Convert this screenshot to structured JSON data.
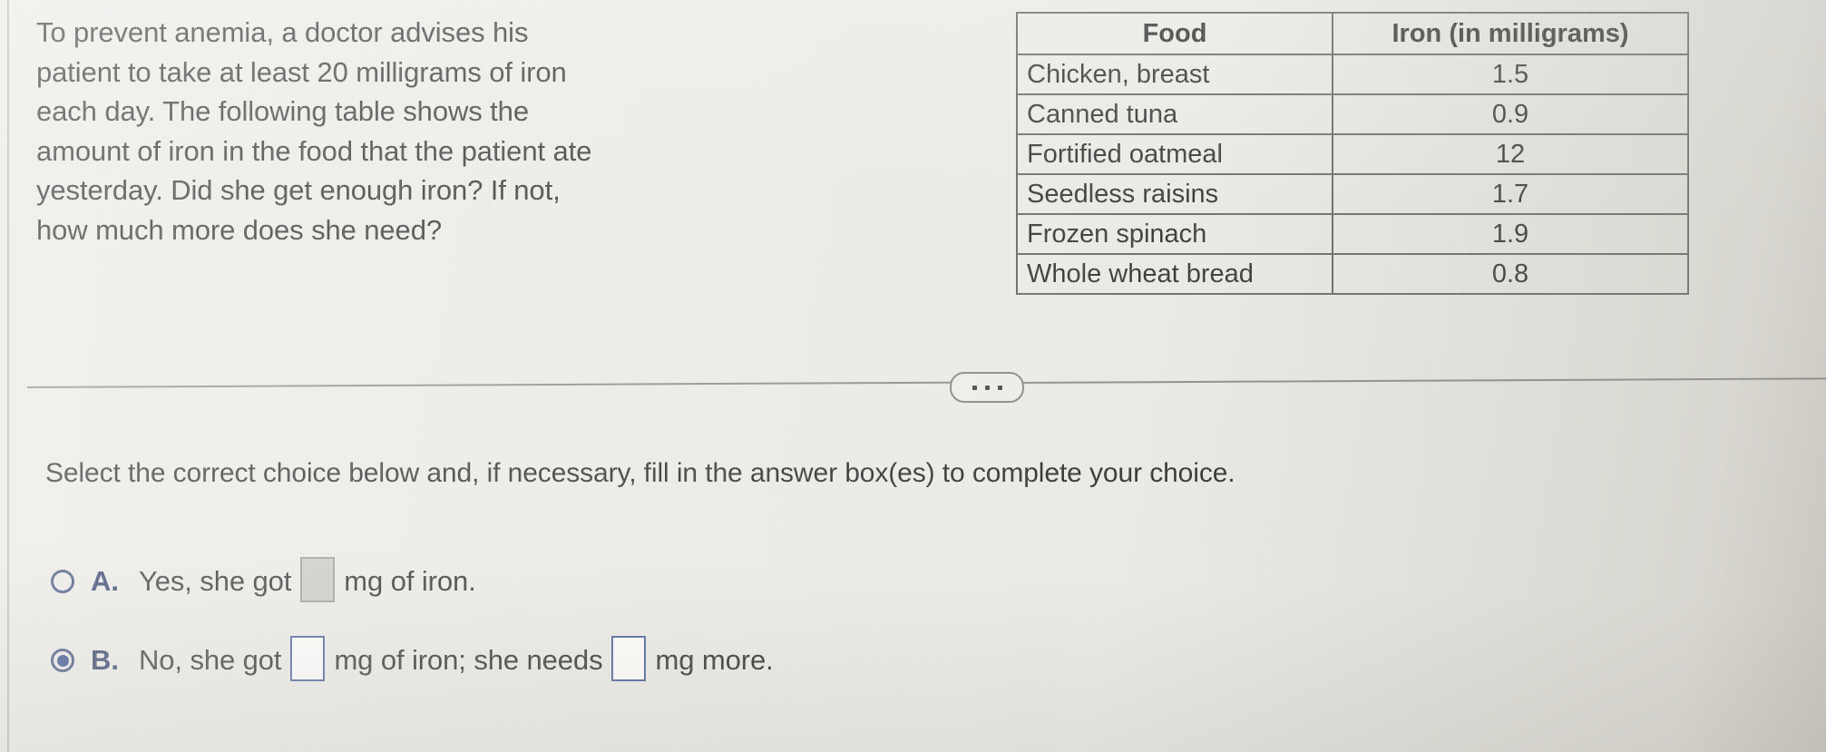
{
  "question": {
    "lines": [
      "To prevent anemia, a doctor advises his",
      "patient to take at least 20 milligrams of iron",
      "each day. The following table shows the",
      "amount of iron in the food that the patient ate",
      "yesterday. Did she get enough iron? If not,",
      "how much more does she need?"
    ]
  },
  "table": {
    "headers": [
      "Food",
      "Iron (in milligrams)"
    ],
    "rows": [
      {
        "food": "Chicken, breast",
        "iron": "1.5"
      },
      {
        "food": "Canned tuna",
        "iron": "0.9"
      },
      {
        "food": "Fortified oatmeal",
        "iron": "12"
      },
      {
        "food": "Seedless raisins",
        "iron": "1.7"
      },
      {
        "food": "Frozen spinach",
        "iron": "1.9"
      },
      {
        "food": "Whole wheat bread",
        "iron": "0.8"
      }
    ]
  },
  "divider": {
    "ellipsis_label": "..."
  },
  "instruction": "Select the correct choice below and, if necessary, fill in the answer box(es) to complete your choice.",
  "choices": [
    {
      "letter": "A.",
      "selected": false,
      "text_before": "Yes, she got",
      "box1_value": "",
      "text_middle": "mg of iron.",
      "box2_value": null,
      "text_after": null,
      "box_state": "disabled"
    },
    {
      "letter": "B.",
      "selected": true,
      "text_before": "No, she got",
      "box1_value": "",
      "text_middle": "mg of iron; she needs",
      "box2_value": "",
      "text_after": "mg more.",
      "box_state": "enabled"
    }
  ],
  "colors": {
    "background": "#eae9e4",
    "text": "#353535",
    "choice_letter": "#2c3c66",
    "radio_border": "#3c4f7c",
    "radio_fill": "#2f4a8a",
    "answer_box_active_border": "#4a6396",
    "answer_box_disabled_fill": "#c9c9c5",
    "table_border": "#6d6e6a",
    "divider_line": "#8e8e8c"
  }
}
